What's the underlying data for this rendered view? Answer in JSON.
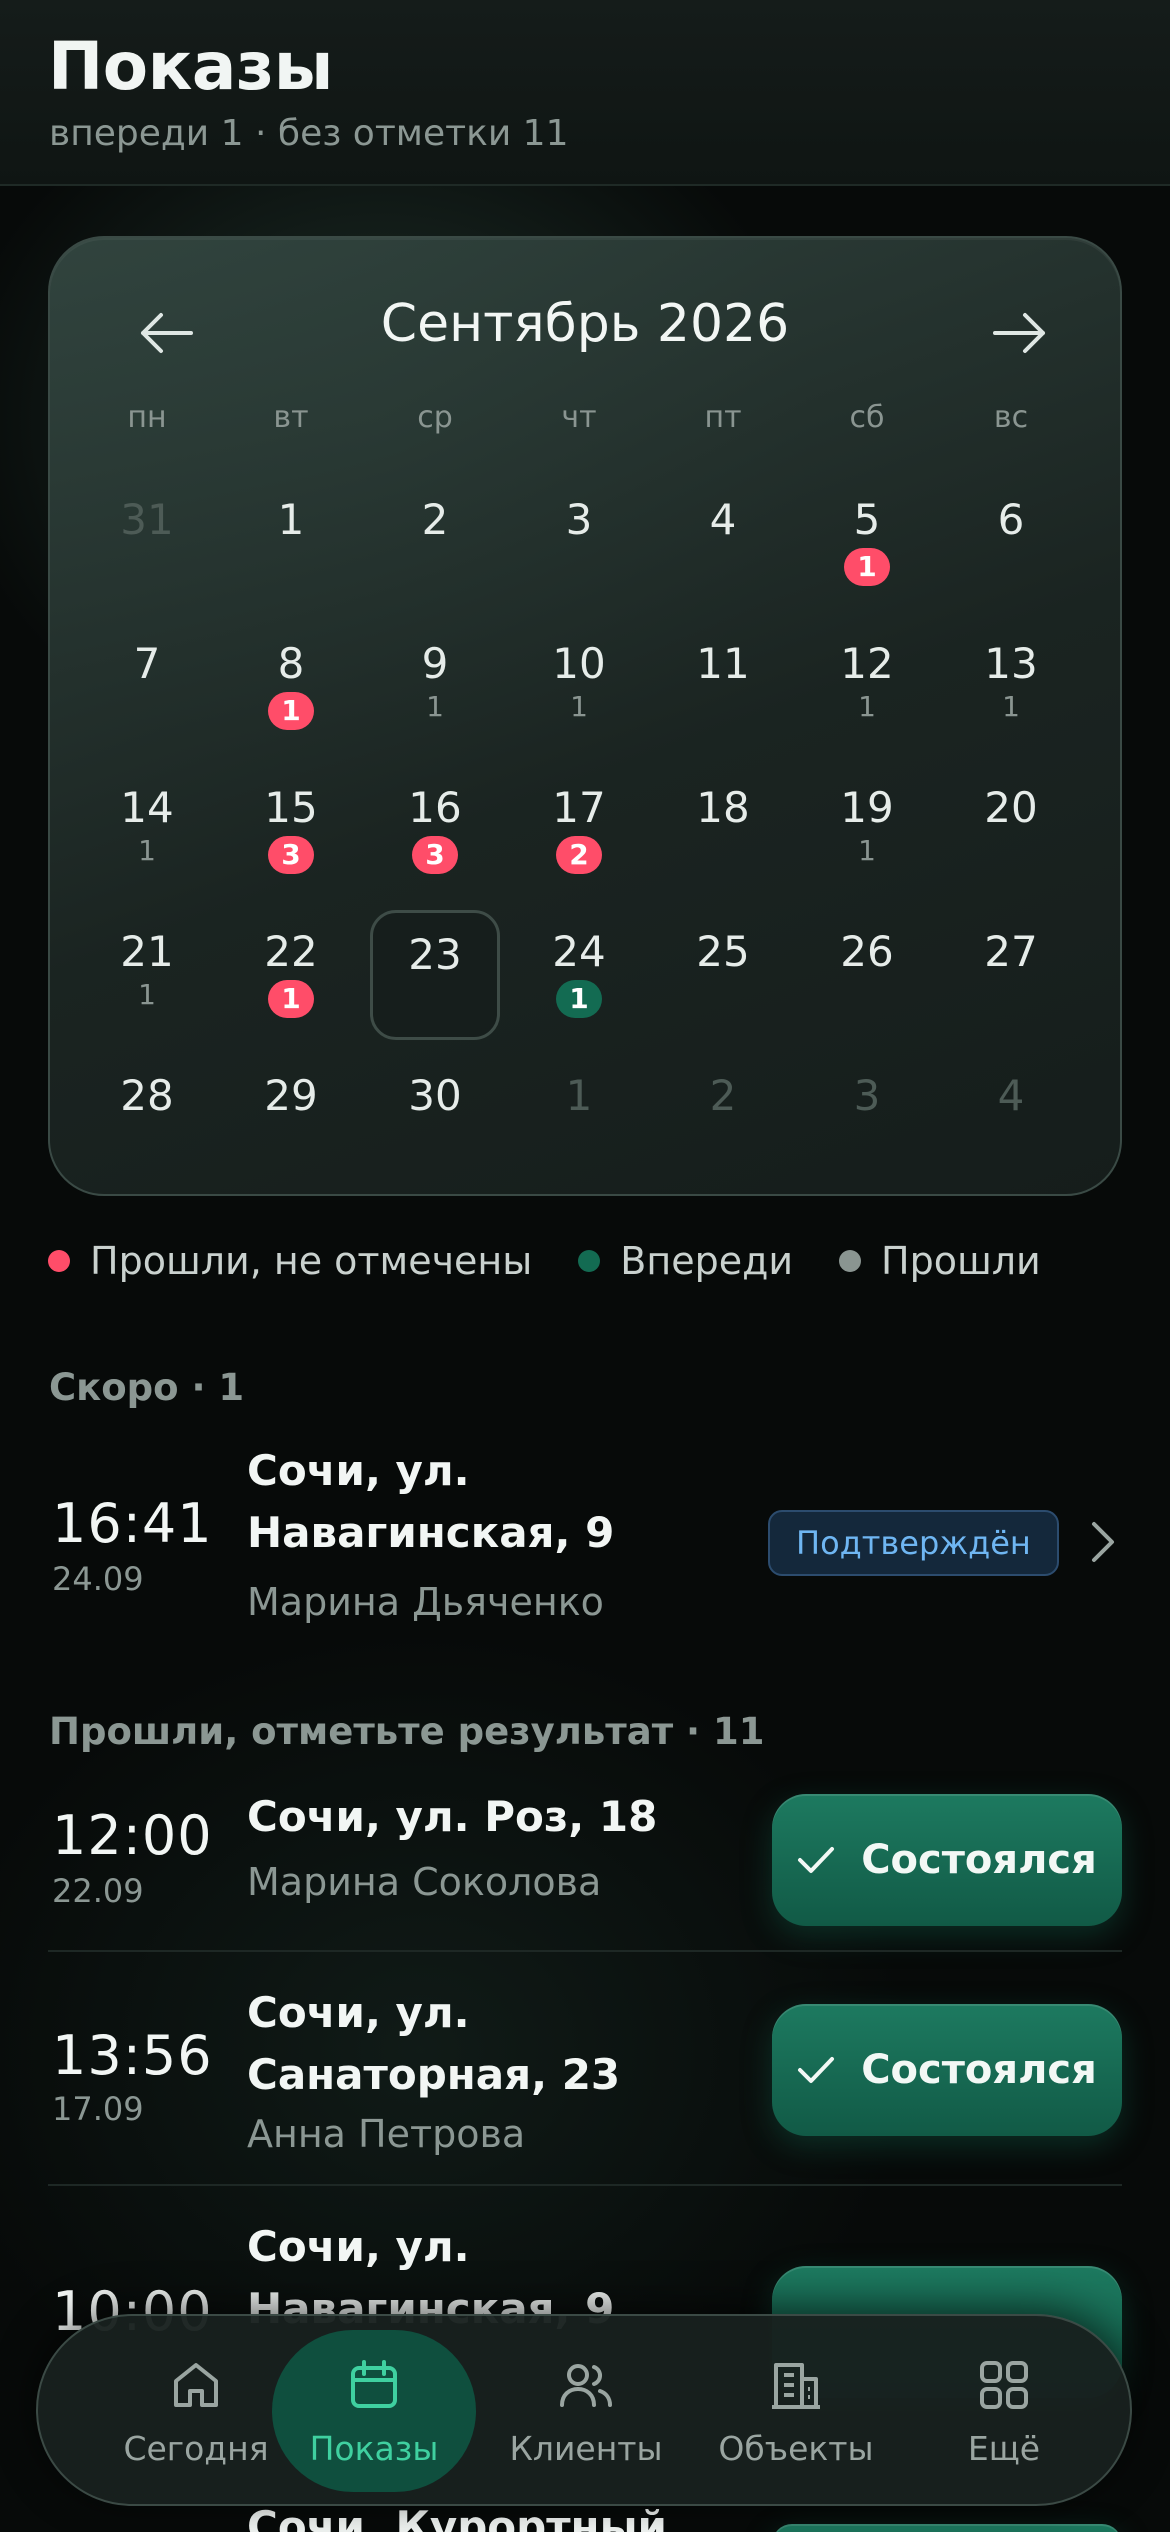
{
  "header": {
    "title": "Показы",
    "subtitle": "впереди 1 · без отметки 11"
  },
  "calendar": {
    "month_label": "Сентябрь 2026",
    "weekdays": [
      "пн",
      "вт",
      "ср",
      "чт",
      "пт",
      "сб",
      "вс"
    ],
    "weeks": [
      [
        {
          "day": "31",
          "other": true
        },
        {
          "day": "1"
        },
        {
          "day": "2"
        },
        {
          "day": "3"
        },
        {
          "day": "4"
        },
        {
          "day": "5",
          "badge": "1",
          "badge_type": "missed"
        },
        {
          "day": "6"
        }
      ],
      [
        {
          "day": "7"
        },
        {
          "day": "8",
          "badge": "1",
          "badge_type": "missed"
        },
        {
          "day": "9",
          "count": "1"
        },
        {
          "day": "10",
          "count": "1"
        },
        {
          "day": "11"
        },
        {
          "day": "12",
          "count": "1"
        },
        {
          "day": "13",
          "count": "1"
        }
      ],
      [
        {
          "day": "14",
          "count": "1"
        },
        {
          "day": "15",
          "badge": "3",
          "badge_type": "missed"
        },
        {
          "day": "16",
          "badge": "3",
          "badge_type": "missed"
        },
        {
          "day": "17",
          "badge": "2",
          "badge_type": "missed"
        },
        {
          "day": "18"
        },
        {
          "day": "19",
          "count": "1"
        },
        {
          "day": "20"
        }
      ],
      [
        {
          "day": "21",
          "count": "1"
        },
        {
          "day": "22",
          "badge": "1",
          "badge_type": "missed"
        },
        {
          "day": "23",
          "today": true
        },
        {
          "day": "24",
          "badge": "1",
          "badge_type": "upcoming"
        },
        {
          "day": "25"
        },
        {
          "day": "26"
        },
        {
          "day": "27"
        }
      ],
      [
        {
          "day": "28"
        },
        {
          "day": "29"
        },
        {
          "day": "30"
        },
        {
          "day": "1",
          "other": true
        },
        {
          "day": "2",
          "other": true
        },
        {
          "day": "3",
          "other": true
        },
        {
          "day": "4",
          "other": true
        }
      ]
    ]
  },
  "legend": [
    {
      "label": "Прошли, не отмечены",
      "color": "#ff4d69"
    },
    {
      "label": "Впереди",
      "color": "#136b52"
    },
    {
      "label": "Прошли",
      "color": "#8a9591"
    }
  ],
  "upcoming": {
    "title": "Скоро · 1",
    "items": [
      {
        "time": "16:41",
        "date": "24.09",
        "address_line1": "Сочи, ул.",
        "address_line2": "Навагинская, 9",
        "client": "Марина Дьяченко",
        "status": "Подтверждён"
      }
    ]
  },
  "past": {
    "title": "Прошли, отметьте результат · 11",
    "button_label": "Состоялся",
    "items": [
      {
        "time": "12:00",
        "date": "22.09",
        "address_line1": "Сочи, ул. Роз, 18",
        "client": "Марина Соколова"
      },
      {
        "time": "13:56",
        "date": "17.09",
        "address_line1": "Сочи, ул.",
        "address_line2": "Санаторная, 23",
        "client": "Анна Петрова"
      },
      {
        "time": "10:00",
        "address_line1": "Сочи, ул.",
        "address_line2": "Навагинская, 9"
      },
      {
        "address_line1": "Сочи, Курортный"
      }
    ]
  },
  "tabbar": {
    "tabs": [
      {
        "label": "Сегодня",
        "icon": "home-icon"
      },
      {
        "label": "Показы",
        "icon": "calendar-icon",
        "active": true
      },
      {
        "label": "Клиенты",
        "icon": "users-icon"
      },
      {
        "label": "Объекты",
        "icon": "building-icon"
      },
      {
        "label": "Ещё",
        "icon": "grid-icon"
      }
    ]
  },
  "colors": {
    "accent": "#1d7a60",
    "missed": "#ff4d69",
    "upcoming": "#136b52",
    "status_blue": "#6fb6f2"
  }
}
